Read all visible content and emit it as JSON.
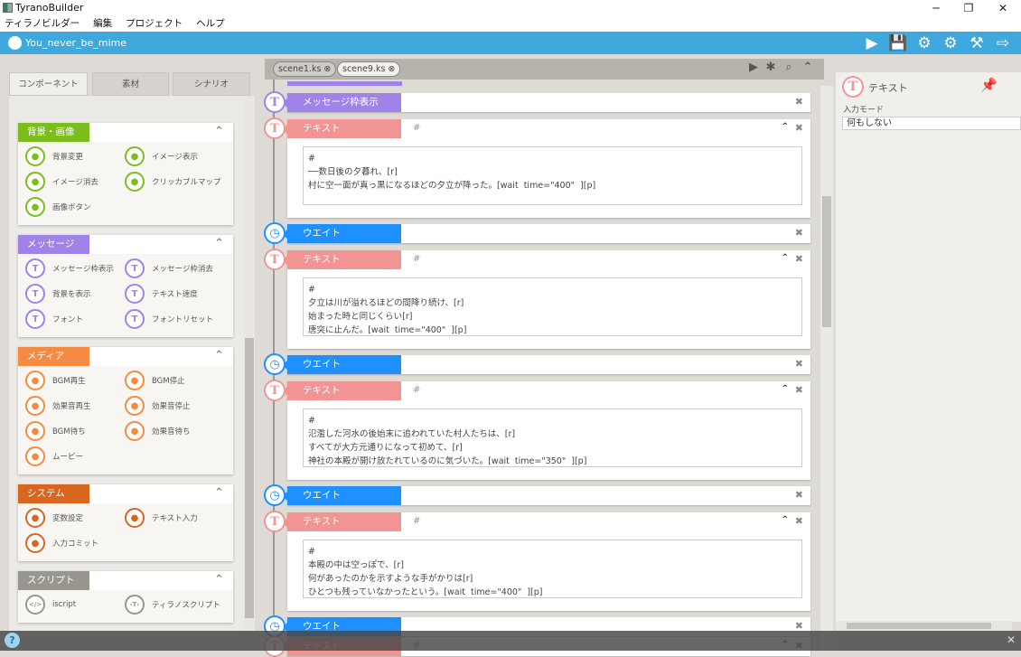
{
  "window": {
    "title": "TyranoBuilder",
    "minimize": "─",
    "restore": "❐",
    "close": "✕"
  },
  "menu": [
    "ティラノビルダー",
    "編集",
    "プロジェクト",
    "ヘルプ"
  ],
  "appbar": {
    "project": "You_never_be_mime",
    "tools": [
      {
        "icon": "play-icon",
        "glyph": "▶"
      },
      {
        "icon": "save-icon",
        "glyph": "💾"
      },
      {
        "icon": "character-settings-icon",
        "glyph": "⚙"
      },
      {
        "icon": "gear-icon",
        "glyph": "⚙"
      },
      {
        "icon": "build-hammer-icon",
        "glyph": "⚒"
      },
      {
        "icon": "export-icon",
        "glyph": "⇨"
      }
    ]
  },
  "left": {
    "tabs": [
      "コンポーネント",
      "素材",
      "シナリオ"
    ],
    "sections": [
      {
        "title": "背景・画像",
        "color": "#7cbd1e",
        "items": [
          "背景変更",
          "イメージ表示",
          "イメージ消去",
          "クリッカブルマップ",
          "画像ボタン"
        ]
      },
      {
        "title": "メッセージ",
        "color": "#a083e8",
        "items": [
          "メッセージ枠表示",
          "メッセージ枠消去",
          "背景を表示",
          "テキスト速度",
          "フォント",
          "フォントリセット"
        ]
      },
      {
        "title": "メディア",
        "color": "#f58a42",
        "items": [
          "BGM再生",
          "BGM停止",
          "効果音再生",
          "効果音停止",
          "BGM待ち",
          "効果音待ち",
          "ムービー"
        ]
      },
      {
        "title": "システム",
        "color": "#d9661f",
        "items": [
          "変数設定",
          "テキスト入力",
          "入力コミット"
        ]
      },
      {
        "title": "スクリプト",
        "color": "#99968f",
        "items": [
          "iscript",
          "ティラノスクリプト"
        ]
      }
    ]
  },
  "center": {
    "tabs": [
      {
        "label": "scene1.ks ⊗"
      },
      {
        "label": "scene9.ks ⊗"
      }
    ],
    "tools": {
      "run": "▶",
      "debug": "✱",
      "search": "⌕",
      "collapse": "⌃"
    },
    "colors": {
      "message": "#a083e8",
      "text": "#f29494",
      "wait": "#1e90ff"
    },
    "blocks": [
      {
        "type": "message",
        "label": "メッセージ枠表示"
      },
      {
        "type": "text",
        "label": "テキスト",
        "value": "#",
        "body": "#\n──数日後の夕暮れ、[r]\n村に空一面が真っ黒になるほどの夕立が降った。[wait  time=\"400\"  ][p]"
      },
      {
        "type": "wait",
        "label": "ウエイト"
      },
      {
        "type": "text",
        "label": "テキスト",
        "value": "#",
        "body": "#\n夕立は川が溢れるほどの間降り続け、[r]\n始まった時と同じくらい[r]\n唐突に止んだ。[wait  time=\"400\"  ][p]"
      },
      {
        "type": "wait",
        "label": "ウエイト"
      },
      {
        "type": "text",
        "label": "テキスト",
        "value": "#",
        "body": "#\n氾濫した河水の後始末に追われていた村人たちは、[r]\nすべてが大方元通りになって初めて、[r]\n神社の本殿が開け放たれているのに気づいた。[wait  time=\"350\"  ][p]"
      },
      {
        "type": "wait",
        "label": "ウエイト"
      },
      {
        "type": "text",
        "label": "テキスト",
        "value": "#",
        "body": "#\n本殿の中は空っぽで、[r]\n何があったのかを示すような手がかりは[r]\nひとつも残っていなかったという。[wait  time=\"400\"  ][p]"
      },
      {
        "type": "wait",
        "label": "ウエイト"
      },
      {
        "type": "text",
        "label": "テキスト",
        "value": "#",
        "collapsed": true
      }
    ]
  },
  "right": {
    "title": "テキスト",
    "mode_label": "入力モード",
    "mode_value": "何もしない"
  }
}
